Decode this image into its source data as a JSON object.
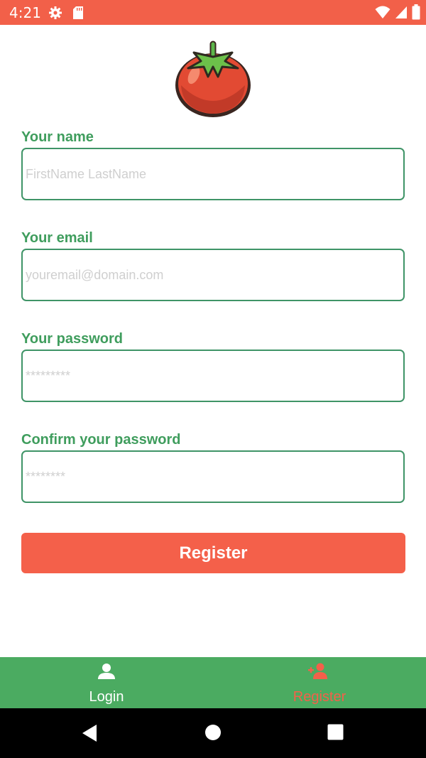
{
  "status_bar": {
    "time": "4:21",
    "background_color": "#f26049",
    "left_icons": [
      "gear-icon",
      "sd-card-icon"
    ],
    "right_icons": [
      "wifi-icon",
      "signal-icon",
      "battery-icon"
    ]
  },
  "logo": {
    "icon": "tomato-icon"
  },
  "form": {
    "name": {
      "label": "Your name",
      "placeholder": "FirstName LastName",
      "value": ""
    },
    "email": {
      "label": "Your email",
      "placeholder": "youremail@domain.com",
      "value": ""
    },
    "password": {
      "label": "Your password",
      "placeholder": "*********",
      "value": ""
    },
    "confirm_password": {
      "label": "Confirm your password",
      "placeholder": "********",
      "value": ""
    },
    "label_color": "#3f9d5d",
    "border_color": "#3f9467"
  },
  "register_button": {
    "label": "Register",
    "color": "#f4604a"
  },
  "bottom_nav": {
    "background_color": "#4bab61",
    "tabs": [
      {
        "label": "Login",
        "icon": "person-icon",
        "active": false,
        "color": "#ffffff"
      },
      {
        "label": "Register",
        "icon": "people-icon",
        "active": true,
        "color": "#f4604a"
      }
    ]
  },
  "system_nav": {
    "buttons": [
      "back-icon",
      "home-icon",
      "recents-icon"
    ]
  }
}
